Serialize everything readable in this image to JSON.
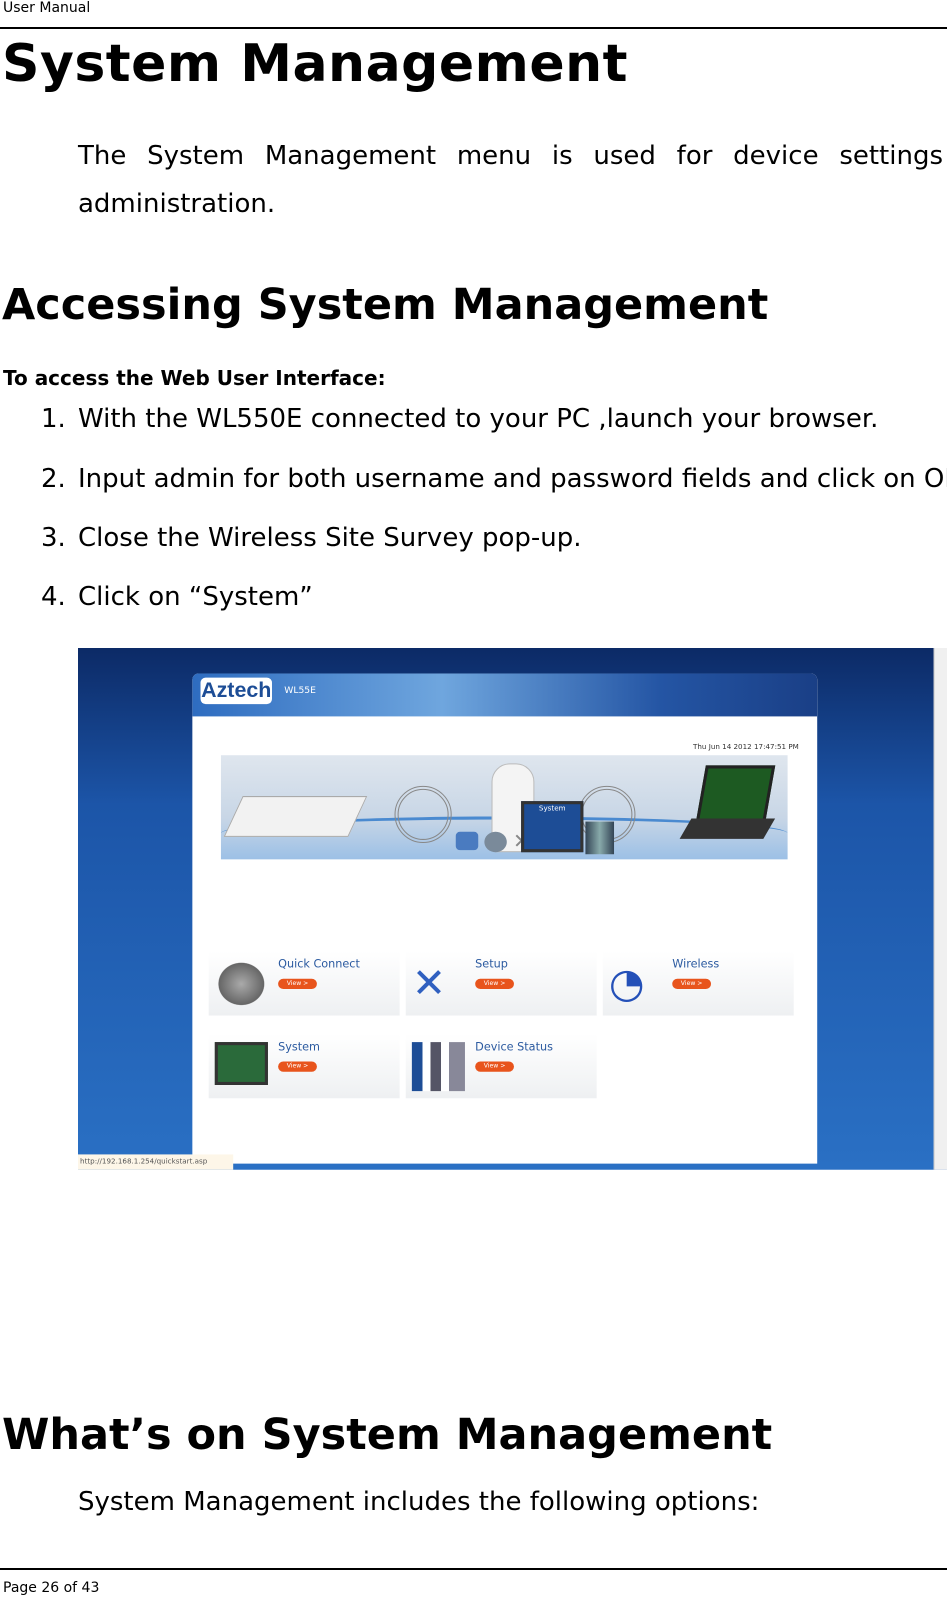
{
  "header": {
    "title": "User Manual"
  },
  "section1": {
    "title": "System Management",
    "intro": "The System Management menu is used for device settings administration."
  },
  "section2": {
    "title": "Accessing System Management",
    "subtitle": "To access the Web User Interface:",
    "steps": [
      {
        "num": "1.",
        "text": "With the WL550E connected to your PC ,launch your browser."
      },
      {
        "num": "2.",
        "text": "Input admin for both username and password fields and click on OK"
      },
      {
        "num": "3.",
        "text": "Close the Wireless Site Survey pop-up."
      },
      {
        "num": "4.",
        "text": "Click on “System”"
      }
    ]
  },
  "screenshot": {
    "logo": "Aztech",
    "model": "WL55E",
    "date": "Thu Jun 14 2012 17:47:51 PM",
    "highlight_label": "System",
    "cards": [
      {
        "title": "Quick Connect",
        "button": "View >"
      },
      {
        "title": "Setup",
        "button": "View >"
      },
      {
        "title": "Wireless",
        "button": "View >"
      },
      {
        "title": "System",
        "button": "View >"
      },
      {
        "title": "Device Status",
        "button": "View >"
      }
    ],
    "status_url": "http://192.168.1.254/quickstart.asp",
    "colors": {
      "accent": "#e8541c",
      "brand": "#1d4d96"
    }
  },
  "section3": {
    "title": "What’s on System Management",
    "text": "System Management includes the following options:"
  },
  "footer": {
    "page": "Page 26  of 43"
  }
}
